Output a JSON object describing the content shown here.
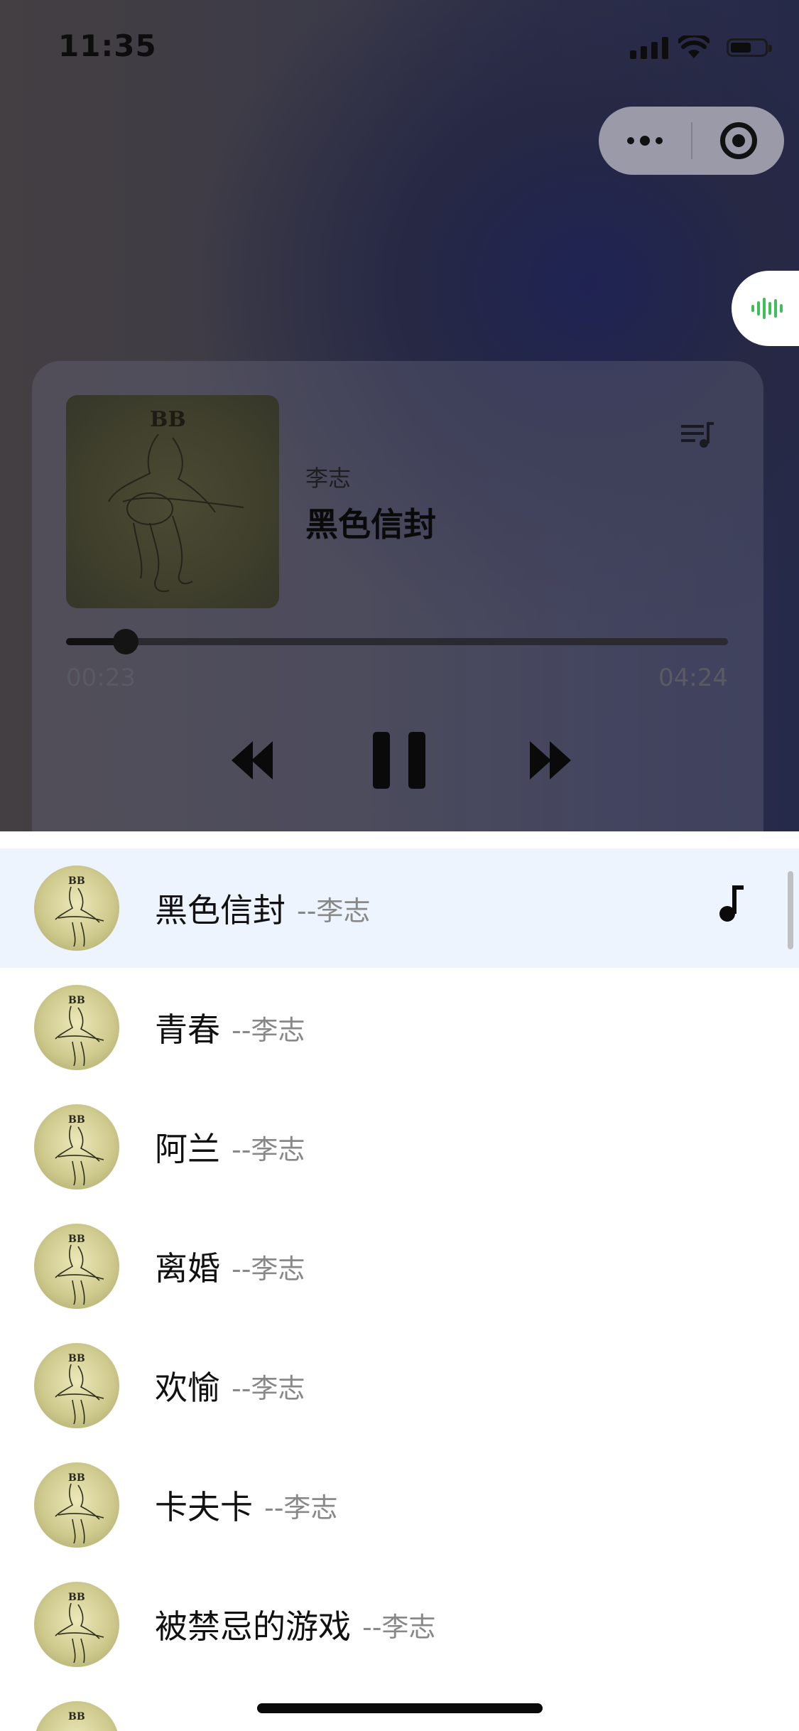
{
  "status_bar": {
    "time": "11:35"
  },
  "capsule": {
    "more_icon": "more-dots-icon",
    "close_icon": "target-circle-icon"
  },
  "float_tab": {
    "icon": "sound-wave-icon",
    "color": "#3fbf5a"
  },
  "player": {
    "artist": "李志",
    "title": "黑色信封",
    "current_time": "00:23",
    "total_time": "04:24",
    "progress_fraction": 0.09,
    "controls": {
      "prev_icon": "rewind-icon",
      "pause_icon": "pause-icon",
      "next_icon": "fast-forward-icon"
    },
    "playlist_icon": "playlist-icon"
  },
  "songs": [
    {
      "title": "黑色信封",
      "artist": "--李志",
      "active": true
    },
    {
      "title": "青春",
      "artist": "--李志"
    },
    {
      "title": "阿兰",
      "artist": "--李志"
    },
    {
      "title": "离婚",
      "artist": "--李志"
    },
    {
      "title": "欢愉",
      "artist": "--李志"
    },
    {
      "title": "卡夫卡",
      "artist": "--李志"
    },
    {
      "title": "被禁忌的游戏",
      "artist": "--李志"
    },
    {
      "title": "",
      "artist": ""
    }
  ],
  "colors": {
    "active_row": "#eef4fd",
    "accent_wave": "#3fbf5a"
  }
}
